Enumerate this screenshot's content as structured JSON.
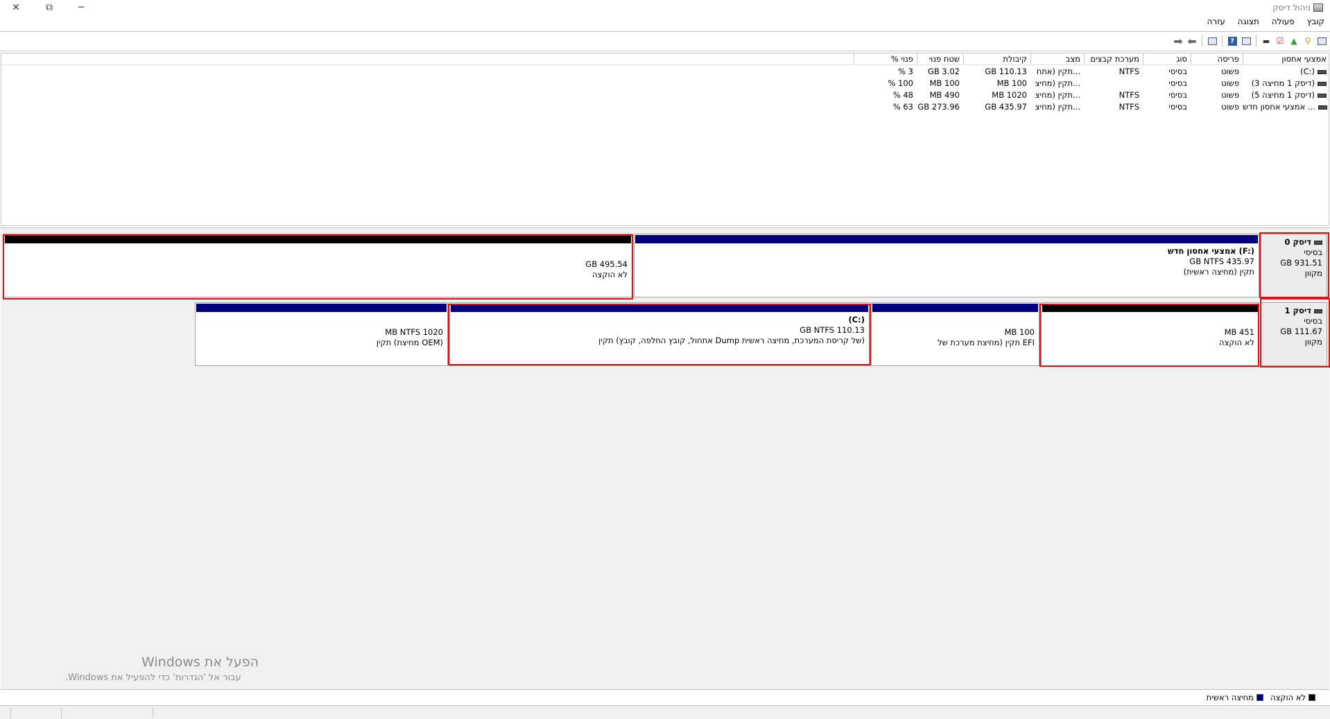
{
  "window": {
    "title": "ניהול דיסק",
    "controls": {
      "minimize": "─",
      "restore": "⧉",
      "close": "✕"
    }
  },
  "menu": [
    "קובץ",
    "פעולה",
    "תצוגה",
    "עזרה"
  ],
  "volume_list": {
    "columns": [
      "אמצעי אחסון",
      "פריסה",
      "סוג",
      "מערכת קבצים",
      "מצב",
      "קיבולת",
      "שטח פנוי",
      "% פנוי"
    ],
    "rows": [
      [
        "(C:)",
        "פשוט",
        "בסיסי",
        "NTFS",
        "תקין (אתח...",
        "GB 110.13",
        "GB 3.02",
        "% 3"
      ],
      [
        "(דיסק 1 מחיצה 3)",
        "פשוט",
        "בסיסי",
        "",
        "תקין (מחיצ...",
        "MB 100",
        "MB 100",
        "% 100"
      ],
      [
        "(דיסק 1 מחיצה 5)",
        "פשוט",
        "בסיסי",
        "NTFS",
        "תקין (מחיצ...",
        "MB 1020",
        "MB 490",
        "% 48"
      ],
      [
        "אמצעי אחסון חדש ...",
        "פשוט",
        "בסיסי",
        "NTFS",
        "תקין (מחיצ...",
        "GB 435.97",
        "GB 273.96",
        "% 63"
      ]
    ]
  },
  "disks": [
    {
      "name": "דיסק 0",
      "type": "בסיסי",
      "size": "GB 931.51",
      "status": "מקוון",
      "partitions": [
        {
          "title": "אמצעי אחסון חדש  (F:)",
          "size_fs": "GB NTFS 435.97",
          "status": "תקין (מחיצה ראשית)",
          "kind": "primary"
        },
        {
          "title": "",
          "size_fs": "GB 495.54",
          "status": "לא הוקצה",
          "kind": "unallocated"
        }
      ]
    },
    {
      "name": "דיסק 1",
      "type": "בסיסי",
      "size": "GB 111.67",
      "status": "מקוון",
      "partitions": [
        {
          "title": "",
          "size_fs": "MB 451",
          "status": "לא הוקצה",
          "kind": "unallocated"
        },
        {
          "title": "",
          "size_fs": "MB 100",
          "status": "תקין (מחיצת מערכת של EFI",
          "kind": "primary"
        },
        {
          "title": "(C:)",
          "size_fs": "GB NTFS 110.13",
          "status": "תקין (אתחול, קובץ החלפה, קובץ Dump של קריסת המערכת, מחיצה ראשית)",
          "kind": "primary"
        },
        {
          "title": "",
          "size_fs": "MB NTFS 1020",
          "status": "תקין (מחיצת OEM)",
          "kind": "primary"
        }
      ]
    }
  ],
  "watermark": {
    "title": "הפעל את Windows",
    "subtitle": "עבור אל 'הגדרות' כדי להפעיל את Windows."
  },
  "legend": [
    {
      "label": "לא הוקצה",
      "color": "#000000"
    },
    {
      "label": "מחיצה ראשית",
      "color": "#00007f"
    }
  ],
  "colors": {
    "primary": "#00007f",
    "unallocated": "#000000",
    "highlight": "#e21010"
  }
}
